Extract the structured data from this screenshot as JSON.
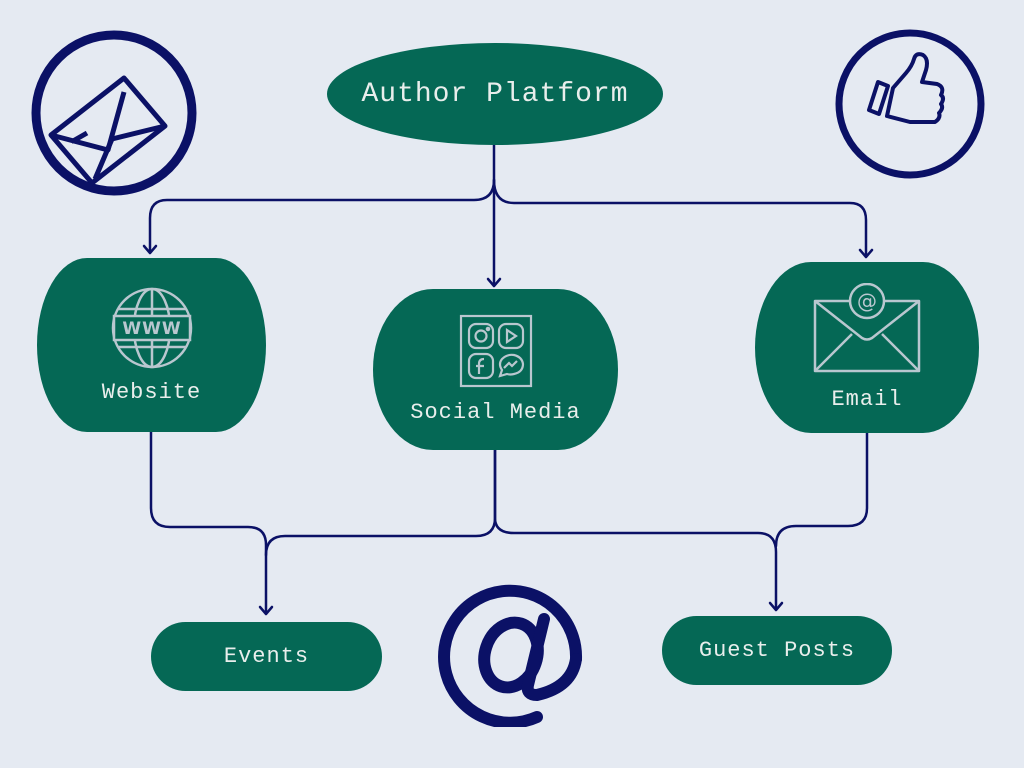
{
  "diagram": {
    "type": "flowchart",
    "title": "Author Platform",
    "colors": {
      "background": "#e5eaf2",
      "node_fill": "#056855",
      "node_text": "#e9eeec",
      "node_icon": "#b9c7cf",
      "connector": "#0b1166",
      "decor_icon": "#0b1166"
    },
    "nodes": {
      "root": {
        "label": "Author Platform"
      },
      "website": {
        "label": "Website",
        "icon": "globe-www-icon"
      },
      "social": {
        "label": "Social Media",
        "icon": "social-apps-icon"
      },
      "email": {
        "label": "Email",
        "icon": "email-at-icon"
      },
      "events": {
        "label": "Events"
      },
      "guest": {
        "label": "Guest Posts"
      }
    },
    "edges": [
      {
        "from": "Author Platform",
        "to": "Website"
      },
      {
        "from": "Author Platform",
        "to": "Social Media"
      },
      {
        "from": "Author Platform",
        "to": "Email"
      },
      {
        "from": "Website",
        "to": "Events"
      },
      {
        "from": "Social Media",
        "to": "Events"
      },
      {
        "from": "Social Media",
        "to": "Guest Posts"
      },
      {
        "from": "Email",
        "to": "Guest Posts"
      }
    ],
    "decorations": [
      "envelope-circle-icon",
      "thumbs-up-circle-icon",
      "at-sign-icon"
    ]
  }
}
